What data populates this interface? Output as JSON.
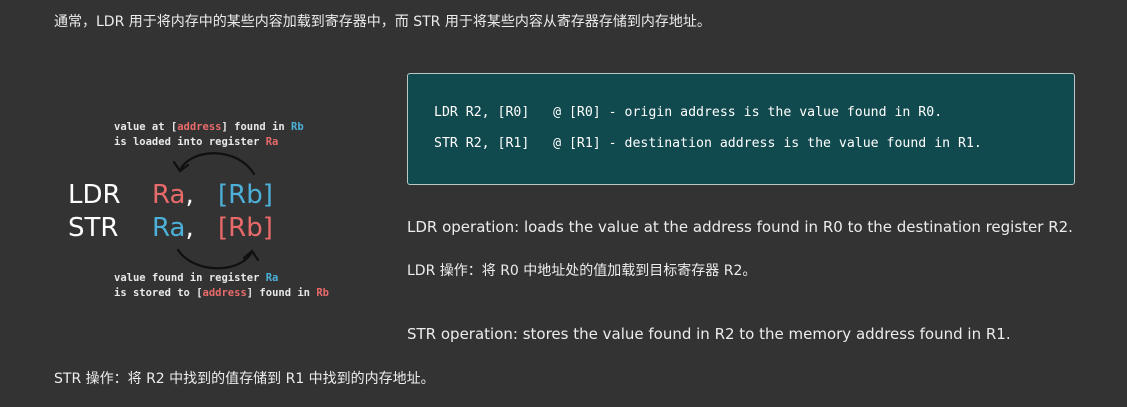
{
  "intro_text": "通常，LDR 用于将内存中的某些内容加载到寄存器中，而 STR 用于将某些内容从寄存器存储到内存地址。",
  "diagram": {
    "top_caption": {
      "line1": [
        "value at ",
        "[",
        "address",
        "]",
        " found in ",
        "Rb"
      ],
      "line2": [
        "is loaded into register ",
        "Ra"
      ]
    },
    "ldr": {
      "op": "LDR",
      "ra": "Ra",
      "comma": ",",
      "rb": "[Rb]"
    },
    "str": {
      "op": "STR",
      "ra": "Ra",
      "comma": ",",
      "rb": "[Rb]"
    },
    "bottom_caption": {
      "line1": [
        "value found in register ",
        "Ra"
      ],
      "line2": [
        "is stored to ",
        "[",
        "address",
        "]",
        " found in ",
        "Rb"
      ]
    },
    "colors": {
      "red": "#e86a6a",
      "cyan": "#4cb0d8",
      "white": "#ffffff",
      "caption": "#e8e8e8",
      "arrow": "#101010"
    }
  },
  "code_box": {
    "line1": "LDR R2, [R0]   @ [R0] - origin address is the value found in R0.",
    "line2": "STR R2, [R1]   @ [R1] - destination address is the value found in R1."
  },
  "paragraphs": {
    "ldr_en": "LDR operation: loads the value at the address found in R0 to the destination register R2.",
    "ldr_zh": "LDR 操作：将 R0 中地址处的值加载到目标寄存器 R2。",
    "str_en": "STR operation: stores the value found in R2 to the memory address found in R1.",
    "str_zh": "STR 操作：将 R2 中找到的值存储到 R1 中找到的内存地址。"
  },
  "colors": {
    "background": "#333333",
    "code_box_bg": "#114a4e"
  }
}
